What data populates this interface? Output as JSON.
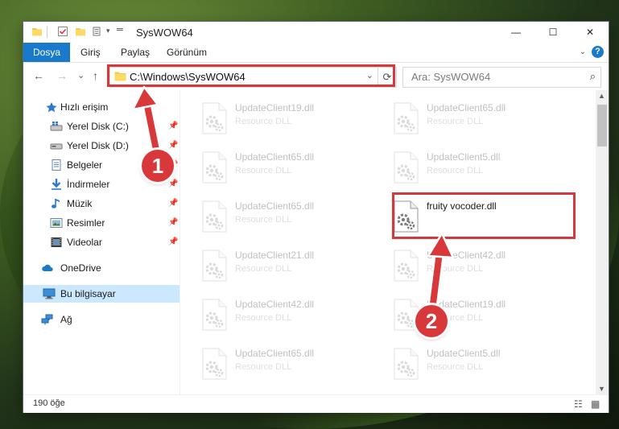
{
  "window": {
    "title": "SysWOW64",
    "controls": {
      "minimize": "—",
      "maximize": "☐",
      "close": "✕"
    }
  },
  "ribbon": {
    "tabs": [
      "Dosya",
      "Giriş",
      "Paylaş",
      "Görünüm"
    ],
    "active_tab": "Dosya",
    "help": "?"
  },
  "nav": {
    "back": "←",
    "forward": "→",
    "recent": "⌄",
    "up": "↑",
    "address": "C:\\Windows\\SysWOW64",
    "search_placeholder": "Ara: SysWOW64"
  },
  "sidebar": {
    "items": [
      {
        "label": "Hızlı erişim",
        "icon": "star-icon",
        "pinned": false
      },
      {
        "label": "Yerel Disk (C:)",
        "icon": "drive-icon",
        "pinned": true
      },
      {
        "label": "Yerel Disk (D:)",
        "icon": "drive-icon",
        "pinned": true
      },
      {
        "label": "Belgeler",
        "icon": "document-icon",
        "pinned": true
      },
      {
        "label": "İndirmeler",
        "icon": "download-icon",
        "pinned": true
      },
      {
        "label": "Müzik",
        "icon": "music-icon",
        "pinned": true
      },
      {
        "label": "Resimler",
        "icon": "pictures-icon",
        "pinned": true
      },
      {
        "label": "Videolar",
        "icon": "video-icon",
        "pinned": true
      },
      {
        "label": "OneDrive",
        "icon": "cloud-icon",
        "pinned": false
      },
      {
        "label": "Bu bilgisayar",
        "icon": "computer-icon",
        "pinned": false,
        "selected": true
      },
      {
        "label": "Ağ",
        "icon": "network-icon",
        "pinned": false
      }
    ]
  },
  "files": [
    {
      "name": "UpdateClient19.dll",
      "type": "Resource DLL",
      "faded": true
    },
    {
      "name": "UpdateClient65.dll",
      "type": "Resource DLL",
      "faded": true
    },
    {
      "name": "UpdateClient65.dll",
      "type": "Resource DLL",
      "faded": true
    },
    {
      "name": "UpdateClient5.dll",
      "type": "Resource DLL",
      "faded": true
    },
    {
      "name": "UpdateClient65.dll",
      "type": "Resource DLL",
      "faded": true
    },
    {
      "name": "fruity vocoder.dll",
      "type": "",
      "faded": false
    },
    {
      "name": "UpdateClient21.dll",
      "type": "Resource DLL",
      "faded": true
    },
    {
      "name": "UpdateClient42.dll",
      "type": "Resource DLL",
      "faded": true
    },
    {
      "name": "UpdateClient42.dll",
      "type": "Resource DLL",
      "faded": true
    },
    {
      "name": "UpdateClient19.dll",
      "type": "Resource DLL",
      "faded": true
    },
    {
      "name": "UpdateClient65.dll",
      "type": "Resource DLL",
      "faded": true
    },
    {
      "name": "UpdateClient5.dll",
      "type": "Resource DLL",
      "faded": true
    }
  ],
  "status": {
    "count": "190 öğe"
  },
  "callouts": [
    {
      "label": "1"
    },
    {
      "label": "2"
    }
  ],
  "colors": {
    "accent": "#1979ca",
    "highlight": "#d9383a",
    "selection": "#cce8ff"
  }
}
